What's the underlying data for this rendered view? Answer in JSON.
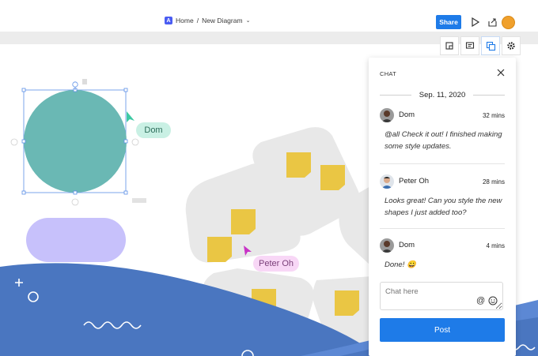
{
  "breadcrumb": {
    "home": "Home",
    "separator": "/",
    "diagram": "New Diagram",
    "app_badge": "A"
  },
  "toolbar": {
    "share_label": "Share"
  },
  "canvas": {
    "cursor_labels": {
      "dom": "Dom",
      "peter": "Peter Oh"
    },
    "colors": {
      "circle": "#6ab8b4",
      "pill": "#c7c1fb",
      "sticky": "#eac644",
      "wedge": "#e8e8e8",
      "wave": "#4a76c0"
    }
  },
  "chat": {
    "title": "CHAT",
    "date": "Sep. 11, 2020",
    "messages": [
      {
        "name": "Dom",
        "time": "32 mins",
        "body": "@all Check it out! I finished making some style updates."
      },
      {
        "name": "Peter Oh",
        "time": "28 mins",
        "body": "Looks great! Can you style the new shapes I just added too?"
      },
      {
        "name": "Dom",
        "time": "4 mins",
        "body": "Done! 😀"
      }
    ],
    "input_placeholder": "Chat here",
    "post_label": "Post"
  },
  "icons": [
    "present-icon",
    "export-icon",
    "user-avatar-icon",
    "page-icon",
    "comment-icon",
    "layers-icon",
    "gear-icon",
    "close-icon",
    "mention-icon",
    "emoji-icon",
    "cursor-arrow-icon"
  ]
}
